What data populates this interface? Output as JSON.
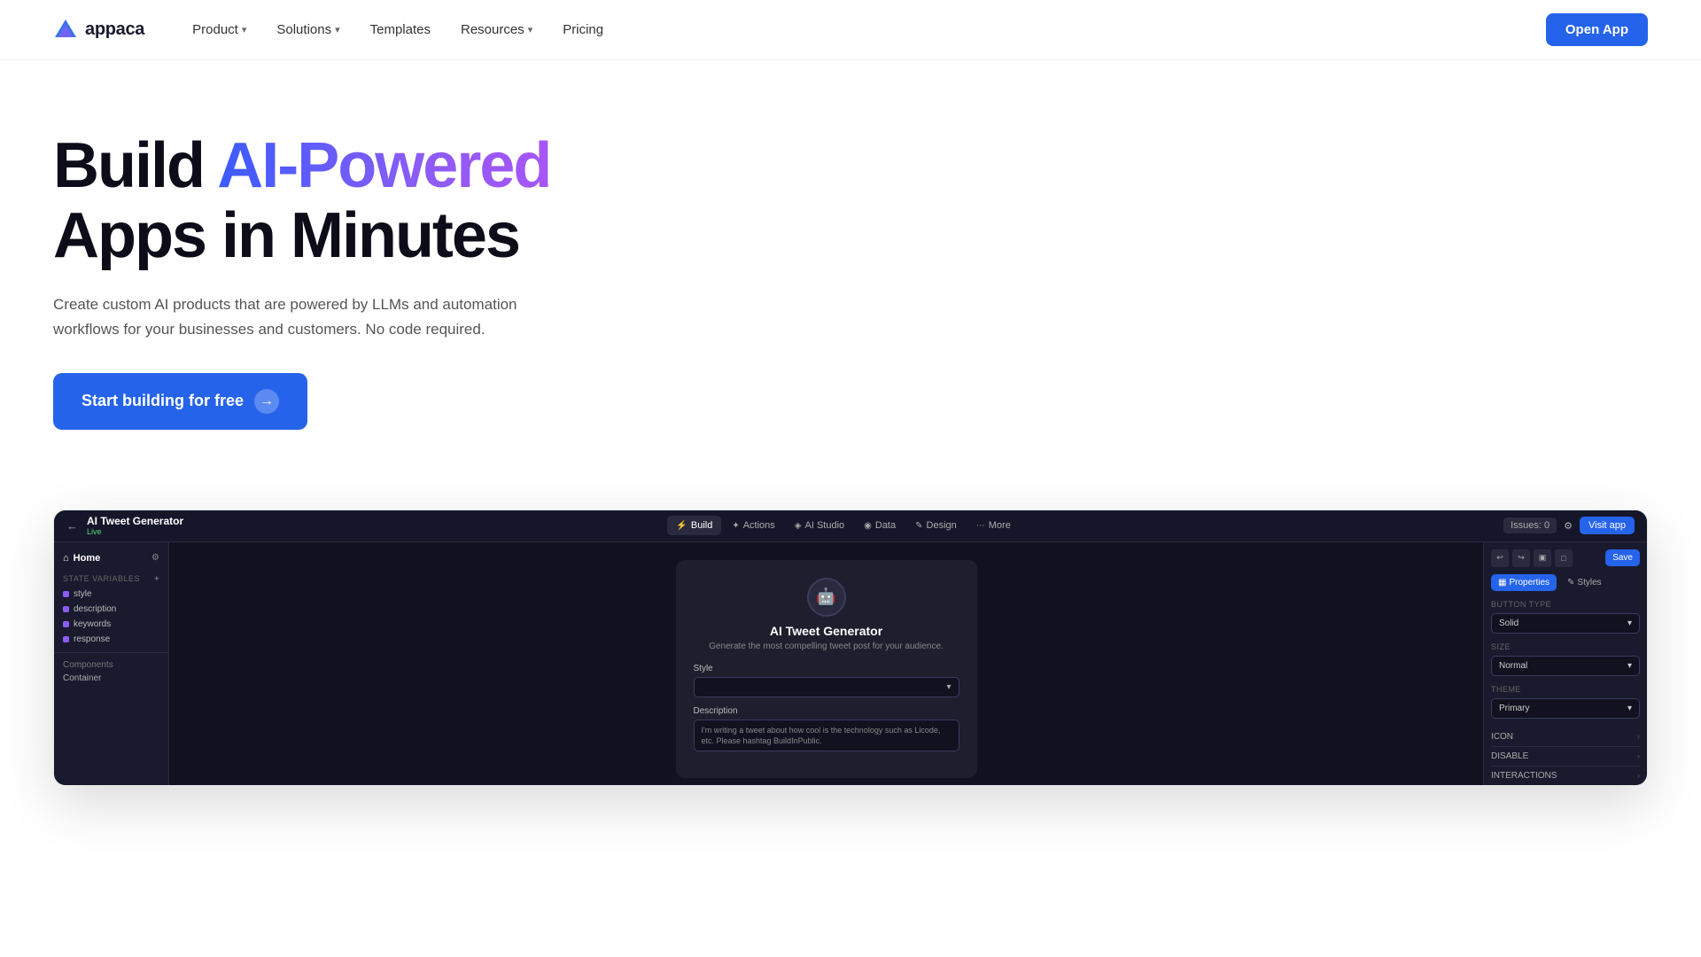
{
  "brand": {
    "name": "appaca",
    "logo_unicode": "✦"
  },
  "nav": {
    "items": [
      {
        "label": "Product",
        "has_dropdown": true
      },
      {
        "label": "Solutions",
        "has_dropdown": true
      },
      {
        "label": "Templates",
        "has_dropdown": false
      },
      {
        "label": "Resources",
        "has_dropdown": true
      },
      {
        "label": "Pricing",
        "has_dropdown": false
      }
    ],
    "cta_label": "Open App"
  },
  "hero": {
    "title_prefix": "Build ",
    "title_gradient": "AI-Powered",
    "title_suffix": "Apps in Minutes",
    "subtitle": "Create custom AI products that are powered by LLMs and automation workflows for your businesses and customers. No code required.",
    "cta_label": "Start building for free",
    "cta_arrow": "→"
  },
  "app_ui": {
    "app_name": "AI Tweet Generator",
    "app_status": "Live",
    "tabs": [
      {
        "label": "Build",
        "icon": "⚡",
        "active": true
      },
      {
        "label": "Actions",
        "icon": "✦",
        "active": false
      },
      {
        "label": "AI Studio",
        "icon": "◈",
        "active": false
      },
      {
        "label": "Data",
        "icon": "◉",
        "active": false
      },
      {
        "label": "Design",
        "icon": "✎",
        "active": false
      },
      {
        "label": "More",
        "icon": "⋯",
        "active": false
      }
    ],
    "issues": "Issues: 0",
    "visit_app_label": "Visit app",
    "save_label": "Save",
    "sidebar": {
      "home_label": "Home",
      "state_section_label": "State variables",
      "variables": [
        {
          "name": "style",
          "color": "#8b5cf6"
        },
        {
          "name": "description",
          "color": "#8b5cf6"
        },
        {
          "name": "keywords",
          "color": "#8b5cf6"
        },
        {
          "name": "response",
          "color": "#8b5cf6"
        }
      ],
      "components_label": "Components",
      "components_sub": "Container"
    },
    "canvas": {
      "app_title": "AI Tweet Generator",
      "app_subtitle": "Generate the most compelling tweet post for your audience.",
      "style_label": "Style",
      "style_placeholder": "",
      "description_label": "Description",
      "description_placeholder": "I'm writing a tweet about how cool is the technology such as Licode, etc. Please hashtag BuildInPublic."
    },
    "right_panel": {
      "tab_properties": "Properties",
      "tab_styles": "Styles",
      "button_type_label": "Button type",
      "button_type_value": "Solid",
      "size_label": "Size",
      "size_value": "Normal",
      "theme_label": "Theme",
      "theme_value": "Primary",
      "icon_label": "ICON",
      "disable_label": "DISABLE",
      "interactions_label": "INTERACTIONS"
    }
  }
}
